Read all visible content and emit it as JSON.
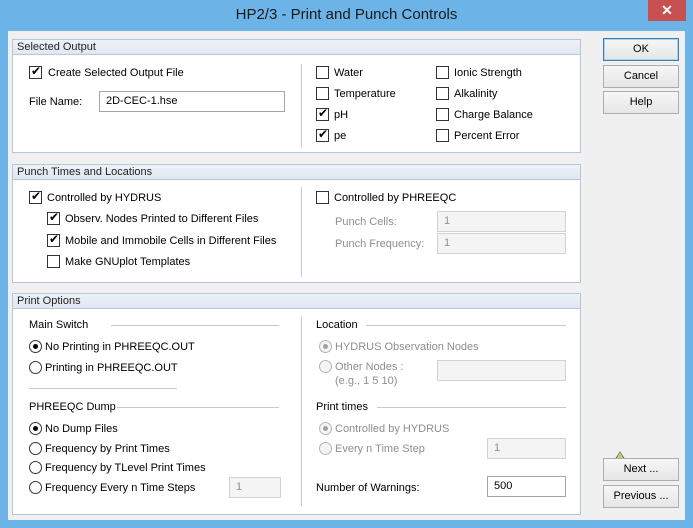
{
  "window": {
    "title": "HP2/3 - Print and Punch Controls",
    "close_glyph": "✕"
  },
  "selected_output": {
    "header": "Selected Output",
    "create_file_label": "Create Selected Output File",
    "file_name_label": "File Name:",
    "file_name_value": "2D-CEC-1.hse",
    "options": [
      {
        "label": "Water",
        "checked": false
      },
      {
        "label": "Temperature",
        "checked": false
      },
      {
        "label": "pH",
        "checked": true
      },
      {
        "label": "pe",
        "checked": true
      },
      {
        "label": "Ionic Strength",
        "checked": false
      },
      {
        "label": "Alkalinity",
        "checked": false
      },
      {
        "label": "Charge Balance",
        "checked": false
      },
      {
        "label": "Percent Error",
        "checked": false
      }
    ]
  },
  "punch": {
    "header": "Punch Times and Locations",
    "controlled_hydrus_label": "Controlled by HYDRUS",
    "observ_nodes_label": "Observ. Nodes Printed to Different Files",
    "mobile_immobile_label": "Mobile and Immobile Cells in Different Files",
    "gnuplot_label": "Make GNUplot Templates",
    "controlled_phreeqc_label": "Controlled by PHREEQC",
    "punch_cells_label": "Punch Cells:",
    "punch_cells_value": "1",
    "punch_frequency_label": "Punch Frequency:",
    "punch_frequency_value": "1"
  },
  "print_options": {
    "header": "Print Options",
    "main_switch_label": "Main Switch",
    "no_printing_label": "No Printing in PHREEQC.OUT",
    "printing_label": "Printing in PHREEQC.OUT",
    "dump_label": "PHREEQC Dump",
    "no_dump_label": "No Dump Files",
    "freq_print_label": "Frequency by Print Times",
    "freq_tlevel_label": "Frequency by TLevel Print Times",
    "freq_every_label": "Frequency Every n Time Steps",
    "freq_every_value": "1",
    "location_label": "Location",
    "hydrus_obs_label": "HYDRUS Observation Nodes",
    "other_nodes_label": "Other Nodes :",
    "other_nodes_example": "(e.g., 1 5 10)",
    "other_nodes_value": "",
    "print_times_label": "Print times",
    "controlled_hydrus_label": "Controlled by HYDRUS",
    "every_n_label": "Every n Time Step",
    "every_n_value": "1",
    "warnings_label": "Number of Warnings:",
    "warnings_value": "500"
  },
  "buttons": {
    "ok": "OK",
    "cancel": "Cancel",
    "help": "Help",
    "next": "Next ...",
    "previous": "Previous ..."
  }
}
